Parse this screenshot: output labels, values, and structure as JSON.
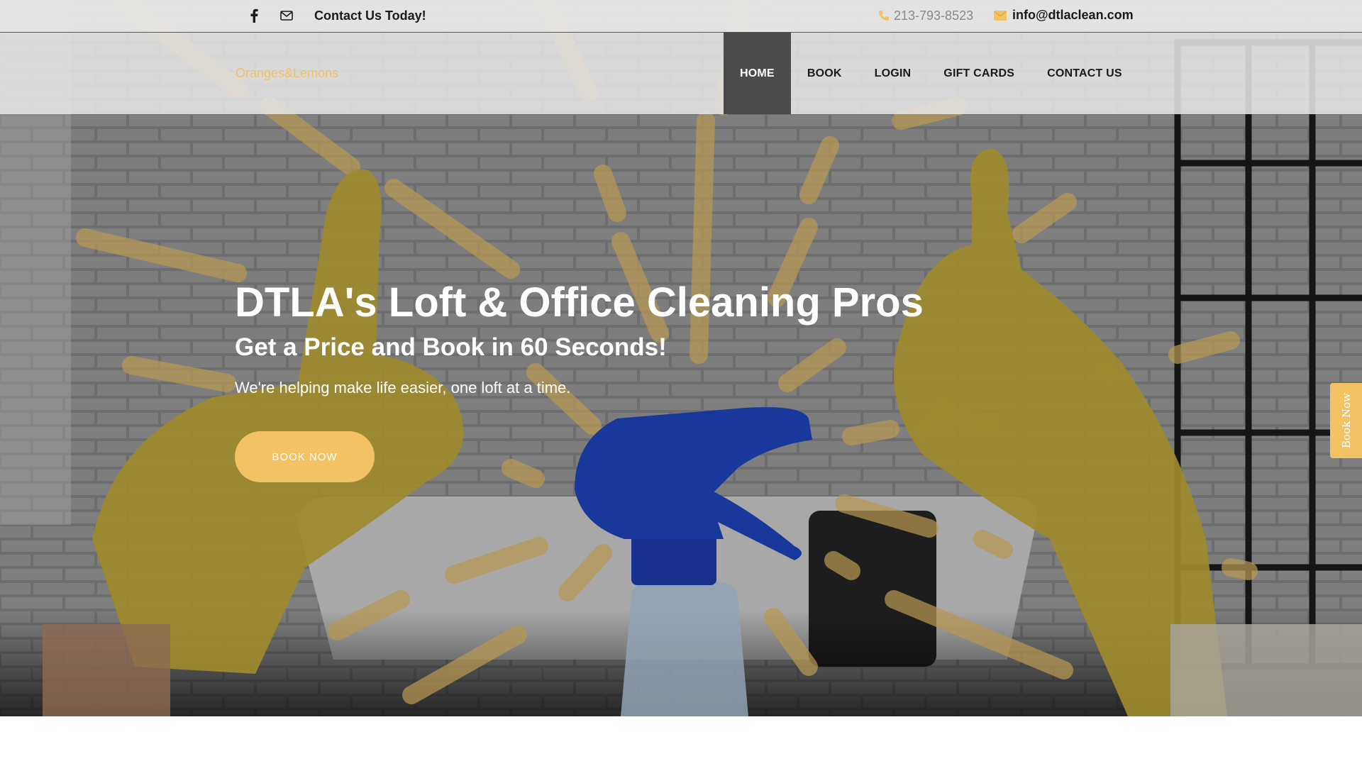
{
  "topbar": {
    "contact_cta": "Contact Us Today!",
    "phone": "213-793-8523",
    "email": "info@dtlaclean.com",
    "icons": [
      "facebook-icon",
      "mail-icon",
      "phone-icon",
      "envelope-icon"
    ]
  },
  "header": {
    "logo": "Oranges&Lemons",
    "nav": [
      {
        "label": "HOME",
        "active": true
      },
      {
        "label": "BOOK",
        "active": false
      },
      {
        "label": "LOGIN",
        "active": false
      },
      {
        "label": "GIFT CARDS",
        "active": false
      },
      {
        "label": "CONTACT US",
        "active": false
      }
    ]
  },
  "hero": {
    "title": "DTLA's Loft & Office Cleaning Pros",
    "subtitle": "Get a Price and Book in 60 Seconds!",
    "tagline": "We're helping make life easier, one loft at a time.",
    "cta": "BOOK NOW"
  },
  "side_tab": {
    "label": "Book Now"
  },
  "colors": {
    "accent": "#f2c265",
    "nav_active_bg": "#4b4b4b",
    "text_dark": "#1a1a1a"
  }
}
